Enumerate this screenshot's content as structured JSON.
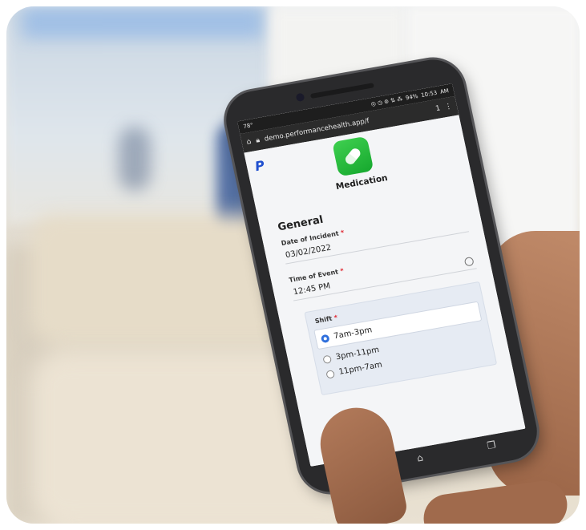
{
  "status_bar": {
    "left": "78°",
    "icons": "◎ ◷ ⊚ ⇅ ⁂",
    "battery": "94%",
    "time": "10:53",
    "ampm": "AM"
  },
  "browser": {
    "url": "demo.performancehealth.app/f",
    "home_icon": "home-icon",
    "lock_icon": "lock-icon",
    "tab_count": "1",
    "menu_icon": "more-vertical-icon"
  },
  "app": {
    "brand_mark": "P",
    "title": "Medication",
    "section": "General",
    "date_label": "Date of Incident",
    "date_value": "03/02/2022",
    "time_label": "Time of Event",
    "time_value": "12:45 PM",
    "shift_label": "Shift",
    "required_mark": "*",
    "shift_options": [
      {
        "label": "7am-3pm",
        "selected": true
      },
      {
        "label": "3pm-11pm",
        "selected": false
      },
      {
        "label": "11pm-7am",
        "selected": false
      }
    ]
  },
  "nav": {
    "back_icon": "back-icon",
    "home_icon": "home-icon",
    "recents_icon": "recents-icon"
  },
  "colors": {
    "app_icon": "#2fbf45",
    "brand": "#1f4fcf",
    "radio_selected": "#2f6fdc",
    "required": "#e0252f"
  }
}
